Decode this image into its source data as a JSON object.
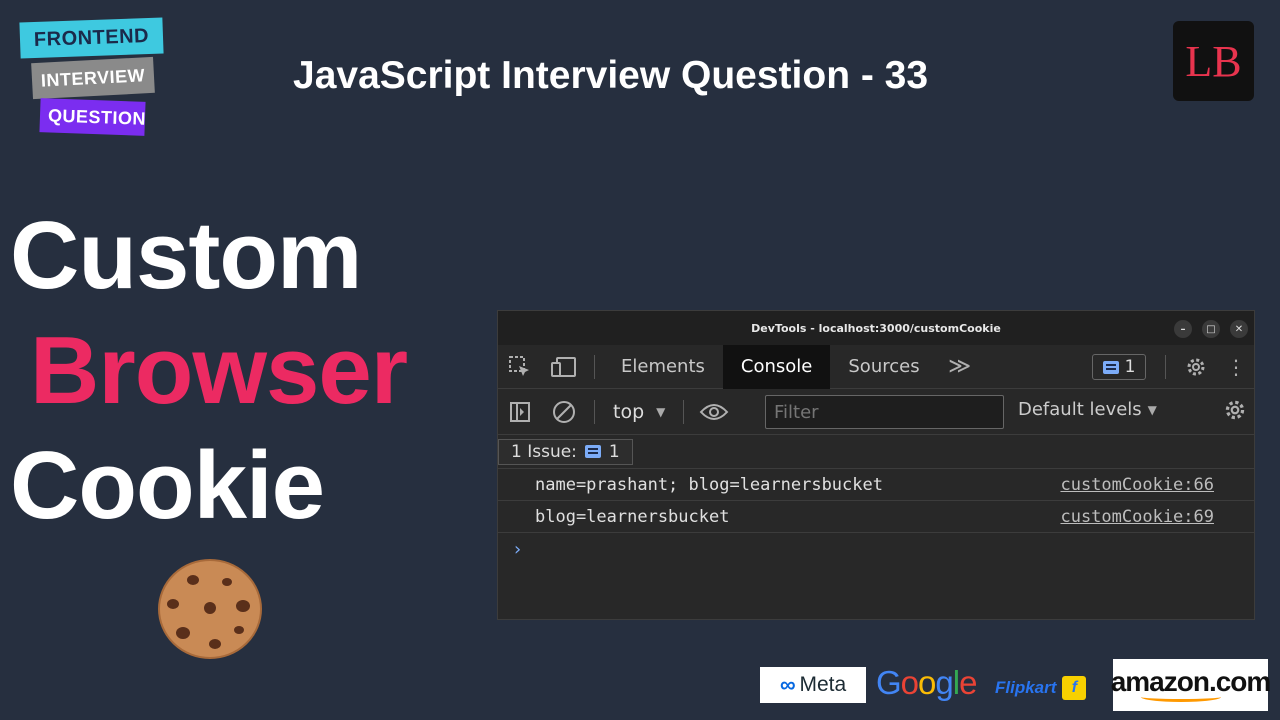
{
  "badge": {
    "line1": "FRONTEND",
    "line2": "INTERVIEW",
    "line3": "QUESTION"
  },
  "title": "JavaScript Interview Question - 33",
  "logo_text": "LB",
  "headline": {
    "word1": "Custom",
    "word2": "Browser",
    "word3": "Cookie"
  },
  "devtools": {
    "window_title": "DevTools - localhost:3000/customCookie",
    "tabs": [
      {
        "label": "Elements",
        "active": false
      },
      {
        "label": "Console",
        "active": true
      },
      {
        "label": "Sources",
        "active": false
      }
    ],
    "issues_count": "1",
    "context": "top",
    "filter_placeholder": "Filter",
    "levels": "Default levels",
    "issue_bar": {
      "label": "1 Issue:",
      "count": "1"
    },
    "logs": [
      {
        "text": "name=prashant; blog=learnersbucket",
        "source": "customCookie:66"
      },
      {
        "text": "blog=learnersbucket",
        "source": "customCookie:69"
      }
    ],
    "prompt": "›"
  },
  "companies": {
    "meta": "Meta",
    "flipkart": "Flipkart",
    "amazon": "amazon.com"
  },
  "colors": {
    "background": "#262f3f",
    "accent_pink": "#ec2a62",
    "badge_cyan": "#3ec9e0",
    "badge_purple": "#7b2df0"
  }
}
